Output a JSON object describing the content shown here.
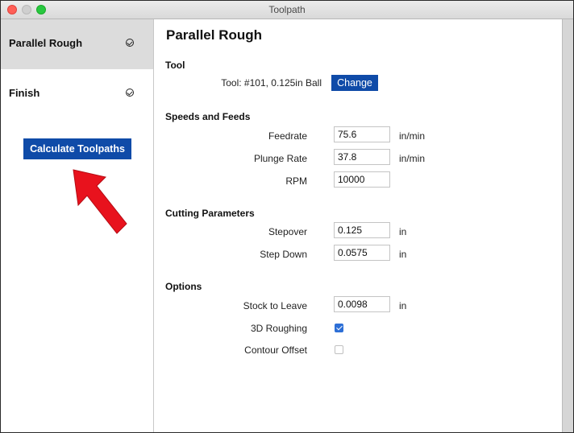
{
  "window": {
    "title": "Toolpath"
  },
  "sidebar": {
    "items": [
      {
        "label": "Parallel Rough",
        "selected": true,
        "status_icon": "check-circle-icon"
      },
      {
        "label": "Finish",
        "selected": false,
        "status_icon": "check-circle-icon"
      }
    ],
    "calculate_label": "Calculate Toolpaths"
  },
  "main": {
    "title": "Parallel Rough",
    "tool": {
      "header": "Tool",
      "value": "Tool: #101, 0.125in Ball",
      "change_label": "Change"
    },
    "speeds": {
      "header": "Speeds and Feeds",
      "rows": [
        {
          "label": "Feedrate",
          "value": "75.6",
          "unit": "in/min"
        },
        {
          "label": "Plunge Rate",
          "value": "37.8",
          "unit": "in/min"
        },
        {
          "label": "RPM",
          "value": "10000",
          "unit": ""
        }
      ]
    },
    "cutting": {
      "header": "Cutting Parameters",
      "rows": [
        {
          "label": "Stepover",
          "value": "0.125",
          "unit": "in"
        },
        {
          "label": "Step Down",
          "value": "0.0575",
          "unit": "in"
        }
      ]
    },
    "options": {
      "header": "Options",
      "stock_label": "Stock to Leave",
      "stock_value": "0.0098",
      "stock_unit": "in",
      "roughing_label": "3D Roughing",
      "roughing_checked": true,
      "contour_label": "Contour Offset",
      "contour_checked": false
    }
  },
  "colors": {
    "accent_button": "#0f4ba8",
    "annotation_arrow": "#e8121d",
    "checkbox_on": "#2d6fd6"
  }
}
